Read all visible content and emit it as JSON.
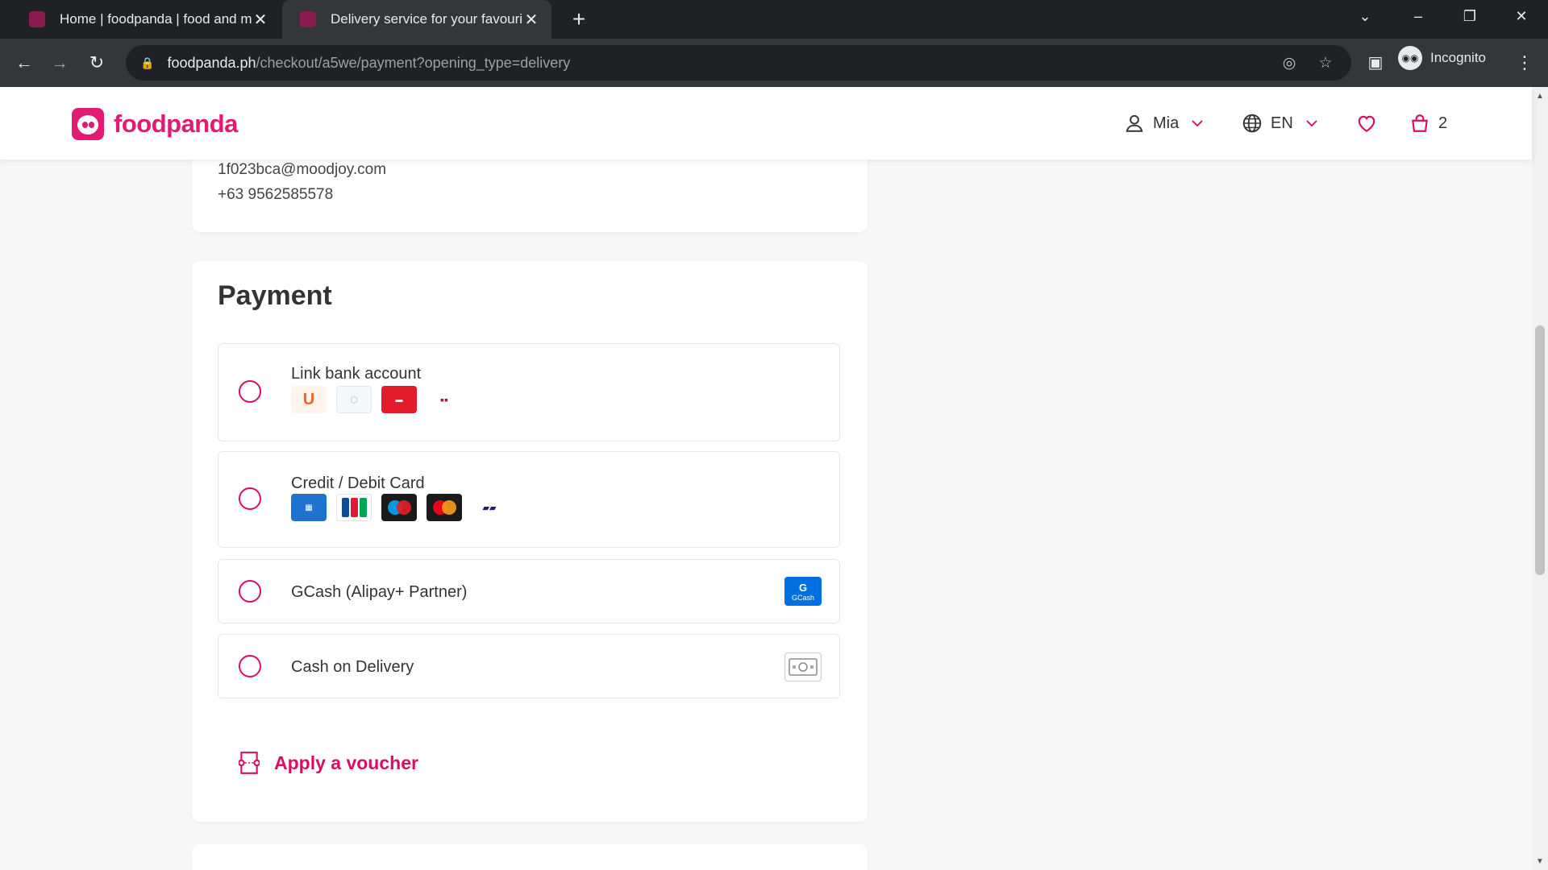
{
  "browser": {
    "tabs": [
      {
        "title": "Home | foodpanda | food and m"
      },
      {
        "title": "Delivery service for your favourit"
      }
    ],
    "url_host": "foodpanda.ph",
    "url_path": "/checkout/a5we/payment?opening_type=delivery",
    "profile_label": "Incognito"
  },
  "header": {
    "logo_text": "foodpanda",
    "user_name": "Mia",
    "language": "EN",
    "cart_count": "2"
  },
  "contact": {
    "email": "1f023bca@moodjoy.com",
    "phone": "+63 9562585578"
  },
  "payment": {
    "title": "Payment",
    "options": [
      {
        "label": "Link bank account",
        "logos": [
          "UB",
          "RCBC",
          "China Bank",
          "BPI"
        ]
      },
      {
        "label": "Credit / Debit Card",
        "logos": [
          "AMEX",
          "JCB",
          "Maestro",
          "Mastercard",
          "VISA"
        ]
      },
      {
        "label": "GCash (Alipay+ Partner)",
        "icon": "gcash-icon",
        "icon_text": "GCash"
      },
      {
        "label": "Cash on Delivery",
        "icon": "cash-icon"
      }
    ],
    "voucher_label": "Apply a voucher"
  },
  "colors": {
    "brand": "#e21b70",
    "radio": "#d70f64"
  }
}
